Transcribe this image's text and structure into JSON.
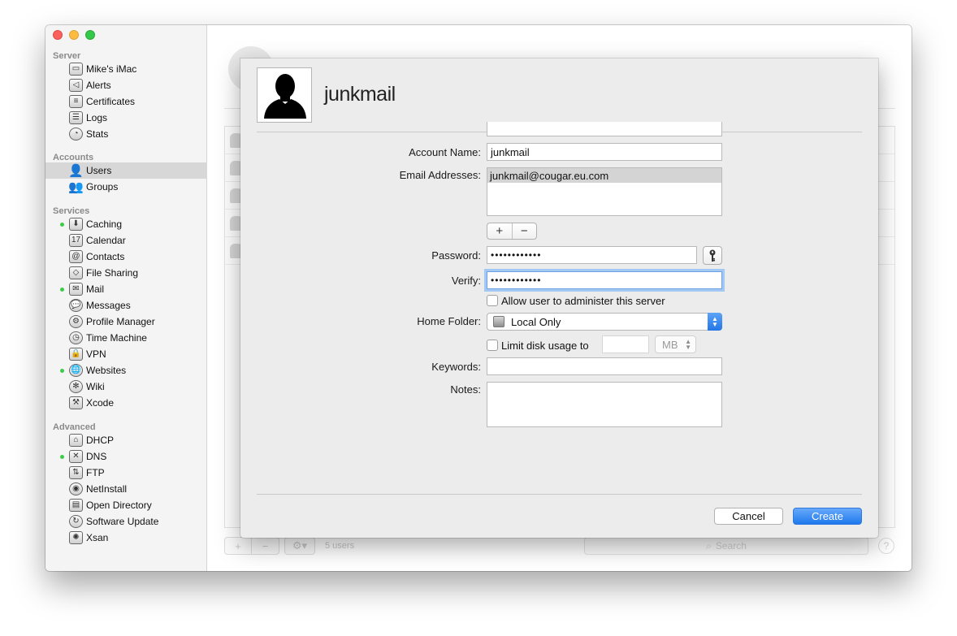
{
  "sidebar": {
    "sections": [
      {
        "title": "Server",
        "items": [
          {
            "label": "Mike's iMac",
            "icon": "imac-icon",
            "glyph": "▭",
            "status": false
          },
          {
            "label": "Alerts",
            "icon": "megaphone-icon",
            "glyph": "◁",
            "status": false
          },
          {
            "label": "Certificates",
            "icon": "certificate-icon",
            "glyph": "≡",
            "status": false
          },
          {
            "label": "Logs",
            "icon": "logs-icon",
            "glyph": "☰",
            "status": false
          },
          {
            "label": "Stats",
            "icon": "stats-icon",
            "glyph": "◔",
            "status": false
          }
        ]
      },
      {
        "title": "Accounts",
        "items": [
          {
            "label": "Users",
            "icon": "user-icon",
            "glyph": "👤",
            "status": false,
            "selected": true
          },
          {
            "label": "Groups",
            "icon": "groups-icon",
            "glyph": "👥",
            "status": false
          }
        ]
      },
      {
        "title": "Services",
        "items": [
          {
            "label": "Caching",
            "icon": "caching-icon",
            "glyph": "⬇",
            "status": true
          },
          {
            "label": "Calendar",
            "icon": "calendar-icon",
            "glyph": "17",
            "status": false
          },
          {
            "label": "Contacts",
            "icon": "contacts-icon",
            "glyph": "@",
            "status": false
          },
          {
            "label": "File Sharing",
            "icon": "file-sharing-icon",
            "glyph": "◇",
            "status": false
          },
          {
            "label": "Mail",
            "icon": "mail-icon",
            "glyph": "✉",
            "status": true
          },
          {
            "label": "Messages",
            "icon": "messages-icon",
            "glyph": "💬",
            "status": false
          },
          {
            "label": "Profile Manager",
            "icon": "profile-manager-icon",
            "glyph": "⚙",
            "status": false
          },
          {
            "label": "Time Machine",
            "icon": "time-machine-icon",
            "glyph": "◷",
            "status": false
          },
          {
            "label": "VPN",
            "icon": "vpn-lock-icon",
            "glyph": "🔒",
            "status": false
          },
          {
            "label": "Websites",
            "icon": "globe-icon",
            "glyph": "🌐",
            "status": true
          },
          {
            "label": "Wiki",
            "icon": "wiki-icon",
            "glyph": "✻",
            "status": false
          },
          {
            "label": "Xcode",
            "icon": "hammer-icon",
            "glyph": "⚒",
            "status": false
          }
        ]
      },
      {
        "title": "Advanced",
        "items": [
          {
            "label": "DHCP",
            "icon": "dhcp-icon",
            "glyph": "⌂",
            "status": false
          },
          {
            "label": "DNS",
            "icon": "dns-icon",
            "glyph": "✕",
            "status": true
          },
          {
            "label": "FTP",
            "icon": "ftp-icon",
            "glyph": "⇅",
            "status": false
          },
          {
            "label": "NetInstall",
            "icon": "netinstall-icon",
            "glyph": "◉",
            "status": false
          },
          {
            "label": "Open Directory",
            "icon": "open-directory-icon",
            "glyph": "▤",
            "status": false
          },
          {
            "label": "Software Update",
            "icon": "software-update-icon",
            "glyph": "↻",
            "status": false
          },
          {
            "label": "Xsan",
            "icon": "xsan-icon",
            "glyph": "✺",
            "status": false
          }
        ]
      }
    ]
  },
  "background": {
    "user_count": "5 users",
    "search_placeholder": "Search",
    "help": "?"
  },
  "sheet": {
    "title": "junkmail",
    "account_name_label": "Account Name:",
    "account_name_value": "junkmail",
    "email_label": "Email Addresses:",
    "email_values": [
      "junkmail@cougar.eu.com"
    ],
    "add_symbol": "+",
    "remove_symbol": "−",
    "password_label": "Password:",
    "password_value": "••••••••••••",
    "verify_label": "Verify:",
    "verify_value": "••••••••••••",
    "admin_checkbox_label": "Allow user to administer this server",
    "home_folder_label": "Home Folder:",
    "home_folder_value": "Local Only",
    "limit_disk_label": "Limit disk usage to",
    "disk_unit": "MB",
    "keywords_label": "Keywords:",
    "notes_label": "Notes:",
    "cancel_label": "Cancel",
    "create_label": "Create"
  },
  "colors": {
    "accent": "#1f79ec",
    "status_dot": "#3dcb4a",
    "selection": "#d7d7d7"
  }
}
